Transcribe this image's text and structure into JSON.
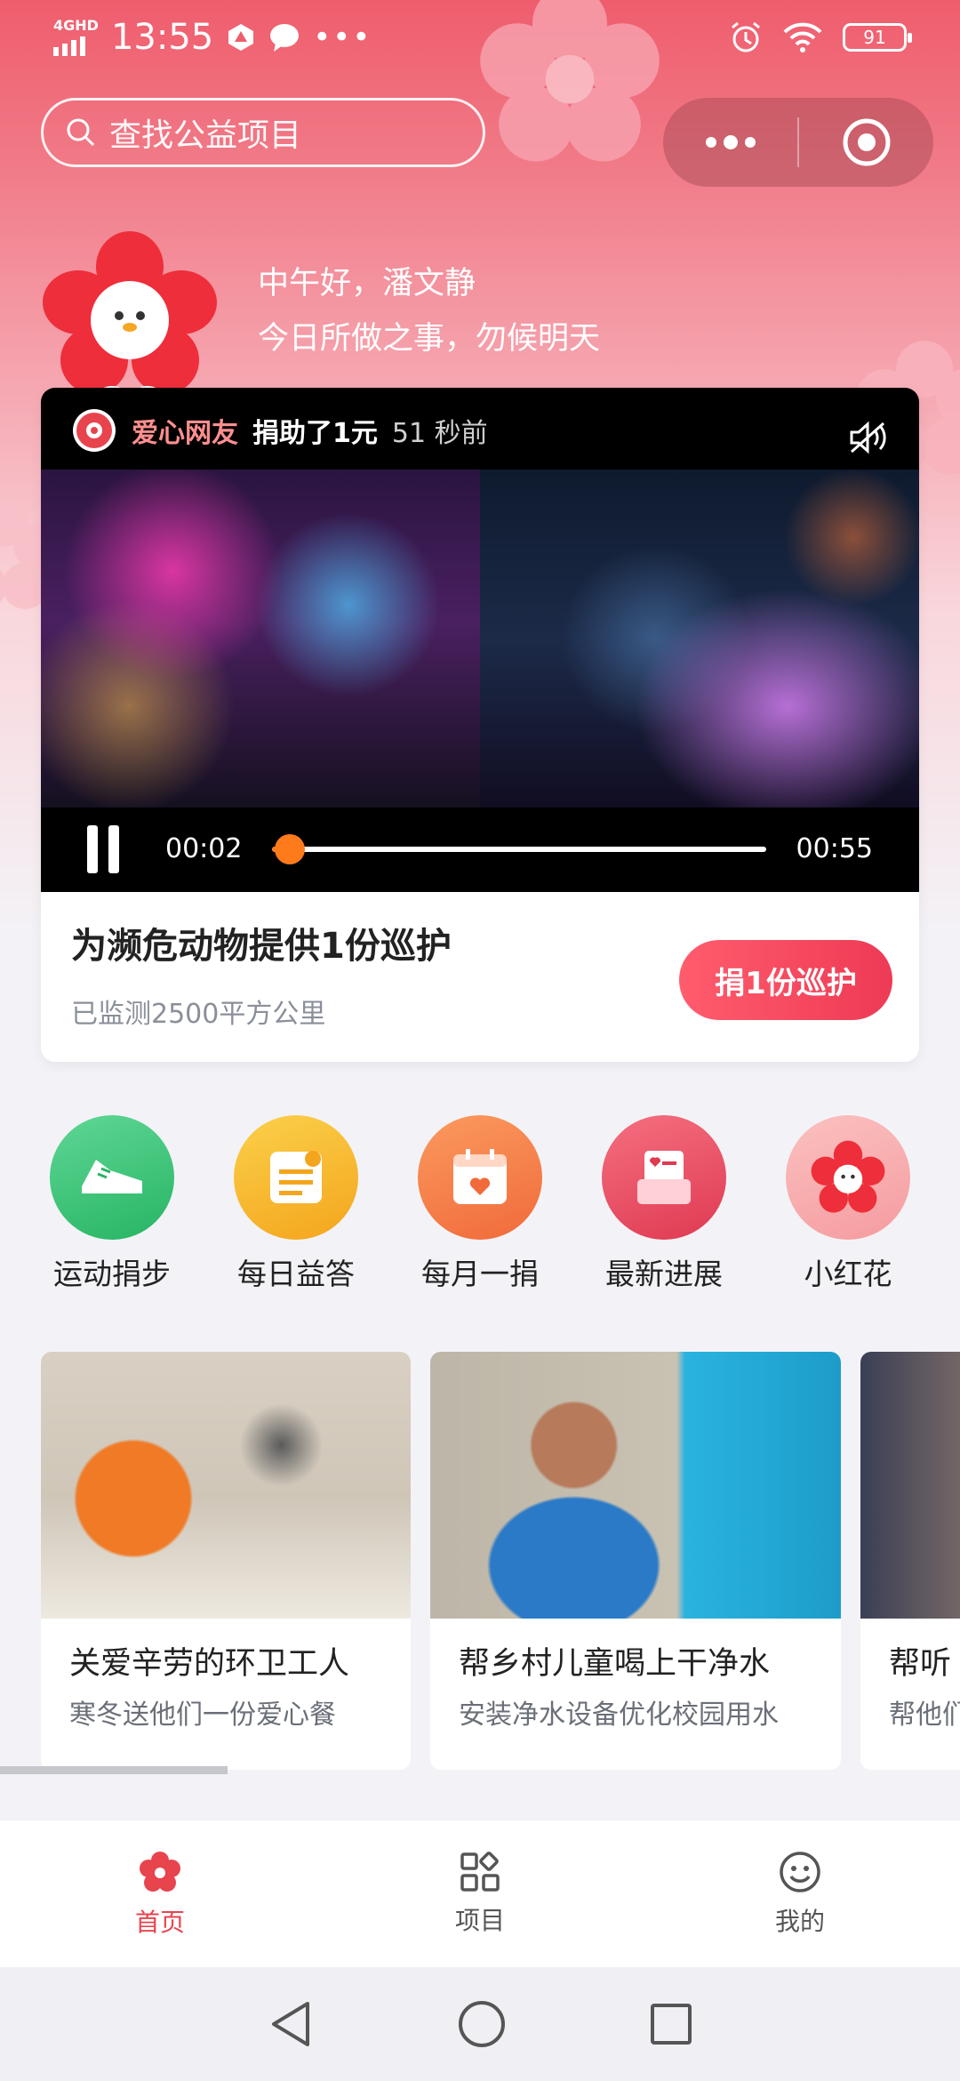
{
  "status_bar": {
    "network": "4GHD",
    "time": "13:55",
    "battery": "91"
  },
  "search": {
    "placeholder": "查找公益项目"
  },
  "greeting": {
    "line1": "中午好，潘文静",
    "line2": "今日所做之事，勿候明天"
  },
  "video_card": {
    "donor": "爱心网友",
    "action": "捐助了1元",
    "time_ago": "51 秒前",
    "current_time": "00:02",
    "duration": "00:55",
    "progress": 0.036,
    "title": "为濒危动物提供1份巡护",
    "subtitle": "已监测2500平方公里",
    "cta": "捐1份巡护"
  },
  "quick_entries": [
    {
      "label": "运动捐步",
      "icon": "sneaker-icon",
      "color": "#3dc57a"
    },
    {
      "label": "每日益答",
      "icon": "quiz-doc-icon",
      "color": "#f7b62a"
    },
    {
      "label": "每月一捐",
      "icon": "calendar-heart-icon",
      "color": "#f57a45"
    },
    {
      "label": "最新进展",
      "icon": "inbox-heart-icon",
      "color": "#ea4f62"
    },
    {
      "label": "小红花",
      "icon": "red-flower-icon",
      "color": "#f8a8a8"
    }
  ],
  "projects": [
    {
      "title": "关爱辛劳的环卫工人",
      "subtitle": "寒冬送他们一份爱心餐"
    },
    {
      "title": "帮乡村儿童喝上干净水",
      "subtitle": "安装净水设备优化校园用水"
    },
    {
      "title": "帮听",
      "subtitle": "帮他们"
    }
  ],
  "tabs": [
    {
      "label": "首页",
      "icon": "flower-home-icon",
      "active": true
    },
    {
      "label": "项目",
      "icon": "grid-apps-icon",
      "active": false
    },
    {
      "label": "我的",
      "icon": "smiley-icon",
      "active": false
    }
  ],
  "colors": {
    "accent": "#e8444e",
    "progress": "#ff7a1a"
  }
}
